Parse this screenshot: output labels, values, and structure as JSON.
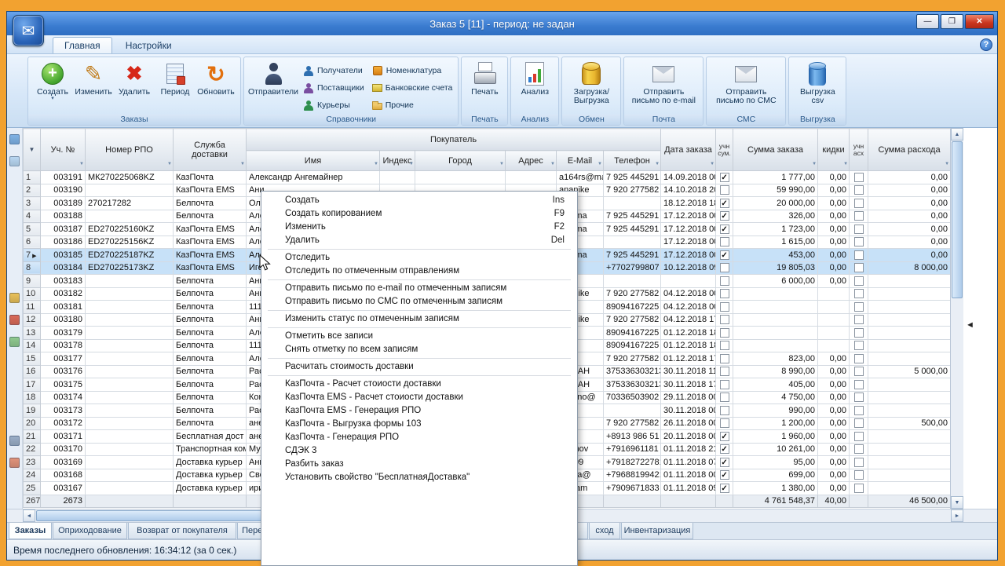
{
  "window": {
    "title": "Заказ 5 [11] - период: не задан",
    "controls": {
      "minimize": "—",
      "maximize": "❒",
      "close": "✕"
    },
    "help": "?"
  },
  "icons": {
    "app": "✉",
    "filter": "▼",
    "corner_filter": "▼",
    "row_marker": "▶",
    "collapse_left": "◄",
    "scroll_up": "▲",
    "scroll_down": "▼",
    "scroll_left": "◄",
    "scroll_right": "►"
  },
  "ribbon": {
    "tabs": [
      {
        "label": "Главная",
        "active": true
      },
      {
        "label": "Настройки",
        "active": false
      }
    ],
    "orders_group": {
      "label": "Заказы",
      "buttons": [
        {
          "label": "Создать",
          "icon": "create-icon",
          "dropdown": true
        },
        {
          "label": "Изменить",
          "icon": "edit-icon"
        },
        {
          "label": "Удалить",
          "icon": "delete-icon"
        },
        {
          "label": "Период",
          "icon": "period-icon"
        },
        {
          "label": "Обновить",
          "icon": "refresh-icon"
        }
      ]
    },
    "ref_group": {
      "label": "Справочники",
      "big": {
        "label": "Отправители",
        "icon": "senders-icon"
      },
      "items": [
        {
          "label": "Получатели",
          "icon": "recipients-icon person-s"
        },
        {
          "label": "Поставщики",
          "icon": "suppliers-icon person-s"
        },
        {
          "label": "Курьеры",
          "icon": "couriers-icon person-s"
        },
        {
          "label": "Номенклатура",
          "icon": "nomenclature-icon"
        },
        {
          "label": "Банковские счета",
          "icon": "bank-accounts-icon"
        },
        {
          "label": "Прочие",
          "icon": "other-icon"
        }
      ]
    },
    "single_groups": [
      {
        "label": "Печать",
        "lines": [
          "Печать"
        ],
        "icon": "print-icon"
      },
      {
        "label": "Анализ",
        "lines": [
          "Анализ"
        ],
        "icon": "analysis-icon"
      },
      {
        "label": "Обмен",
        "lines": [
          "Загрузка/",
          "Выгрузка"
        ],
        "icon": "exchange-icon"
      },
      {
        "label": "Почта",
        "lines": [
          "Отправить",
          "письмо по e-mail"
        ],
        "icon": "email-icon"
      },
      {
        "label": "СМС",
        "lines": [
          "Отправить",
          "письмо по СМС"
        ],
        "icon": "sms-icon"
      },
      {
        "label": "Выгрузка",
        "lines": [
          "Выгрузка",
          "csv"
        ],
        "icon": "csv-icon"
      }
    ]
  },
  "table": {
    "group_header": "Покупатель",
    "columns": [
      "",
      "Уч. №",
      "Номер РПО",
      "Служба доставки",
      "Имя",
      "Индекс",
      "Город",
      "Адрес",
      "E-Mail",
      "Телефон",
      "Дата заказа",
      "учн сум.",
      "Сумма заказа",
      "кидки",
      "учн асх",
      "Сумма расхода"
    ],
    "rows": [
      [
        "1",
        "003191",
        "МК270225068KZ",
        "КазПочта",
        "Александр Ангемайнер",
        "",
        "",
        "",
        "a164rs@ma",
        "7 925 445291",
        "14.09.2018 00:",
        true,
        "1 777,00",
        "0,00",
        false,
        "0,00"
      ],
      [
        "2",
        "003190",
        "",
        "КазПочта EMS",
        "Ани",
        "",
        "",
        "",
        "ananike",
        "7 920 277582",
        "14.10.2018 20:",
        false,
        "59 990,00",
        "0,00",
        false,
        "0,00"
      ],
      [
        "3",
        "003189",
        "270217282",
        "Белпочта",
        "Оле",
        "",
        "",
        "",
        "",
        "",
        "18.12.2018 18:",
        true,
        "20 000,00",
        "0,00",
        false,
        "0,00"
      ],
      [
        "4",
        "003188",
        "",
        "Белпочта",
        "Але",
        "",
        "",
        "",
        "rs@ma",
        "7 925 445291",
        "17.12.2018 00:",
        true,
        "326,00",
        "0,00",
        false,
        "0,00"
      ],
      [
        "5",
        "003187",
        "ED270225160KZ",
        "КазПочта EMS",
        "Але",
        "",
        "",
        "",
        "rs@ma",
        "7 925 445291",
        "17.12.2018 00:",
        true,
        "1 723,00",
        "0,00",
        false,
        "0,00"
      ],
      [
        "6",
        "003186",
        "ED270225156KZ",
        "КазПочта EMS",
        "Але",
        "",
        "",
        "",
        "",
        "",
        "17.12.2018 00:",
        false,
        "1 615,00",
        "0,00",
        false,
        "0,00"
      ],
      [
        "7",
        "003185",
        "ED270225187KZ",
        "КазПочта EMS",
        "Але",
        "",
        "",
        "",
        "rs@ma",
        "7 925 445291",
        "17.12.2018 00:",
        true,
        "453,00",
        "0,00",
        false,
        "0,00"
      ],
      [
        "8",
        "003184",
        "ED270225173KZ",
        "КазПочта EMS",
        "Иго",
        "",
        "",
        "",
        "",
        "+7702799807",
        "10.12.2018 09:",
        false,
        "19 805,03",
        "0,00",
        false,
        "8 000,00"
      ],
      [
        "9",
        "003183",
        "",
        "Белпочта",
        "Ани",
        "",
        "",
        "",
        "",
        "",
        "",
        false,
        "6 000,00",
        "0,00",
        false,
        ""
      ],
      [
        "10",
        "003182",
        "",
        "Белпочта",
        "Ани",
        "",
        "",
        "",
        "ananike",
        "7 920 277582",
        "04.12.2018 00:",
        false,
        "",
        "",
        false,
        ""
      ],
      [
        "11",
        "003181",
        "",
        "Белпочта",
        "111",
        "",
        "",
        "",
        "",
        "89094167225",
        "04.12.2018 00:",
        false,
        "",
        "",
        false,
        ""
      ],
      [
        "12",
        "003180",
        "",
        "Белпочта",
        "Ани",
        "",
        "",
        "",
        "ananike",
        "7 920 277582",
        "04.12.2018 17:",
        false,
        "",
        "",
        false,
        ""
      ],
      [
        "13",
        "003179",
        "",
        "Белпочта",
        "Але",
        "",
        "",
        "",
        "",
        "89094167225",
        "01.12.2018 18:",
        false,
        "",
        "",
        false,
        ""
      ],
      [
        "14",
        "003178",
        "",
        "Белпочта",
        "111",
        "",
        "",
        "",
        "",
        "89094167225",
        "01.12.2018 18:",
        false,
        "",
        "",
        false,
        ""
      ],
      [
        "15",
        "003177",
        "",
        "Белпочта",
        "Але",
        "",
        "",
        "",
        "",
        "7 920 277582",
        "01.12.2018 17:",
        false,
        "823,00",
        "0,00",
        false,
        ""
      ],
      [
        "16",
        "003176",
        "",
        "Белпочта",
        "Рас",
        "",
        "",
        "",
        "5OMAH",
        "375336303213",
        "30.11.2018 11:",
        false,
        "8 990,00",
        "0,00",
        false,
        "5 000,00"
      ],
      [
        "17",
        "003175",
        "",
        "Белпочта",
        "Рас",
        "",
        "",
        "",
        "5OMAH",
        "375336303213",
        "30.11.2018 17:",
        false,
        "405,00",
        "0,00",
        false,
        ""
      ],
      [
        "18",
        "003174",
        "",
        "Белпочта",
        "Кон",
        "",
        "",
        "",
        "ristiano@",
        "70336503902",
        "29.11.2018 00:",
        false,
        "4 750,00",
        "0,00",
        false,
        ""
      ],
      [
        "19",
        "003173",
        "",
        "Белпочта",
        "Рас",
        "",
        "",
        "",
        "",
        "",
        "30.11.2018 00:",
        false,
        "990,00",
        "0,00",
        false,
        ""
      ],
      [
        "20",
        "003172",
        "",
        "Белпочта",
        "ане",
        "",
        "",
        "",
        "",
        "7 920 277582",
        "26.11.2018 00:",
        false,
        "1 200,00",
        "0,00",
        false,
        "500,00"
      ],
      [
        "21",
        "003171",
        "",
        "Бесплатная дост",
        "ане",
        "",
        "",
        "",
        "",
        "+8913 986 51",
        "20.11.2018 00:",
        true,
        "1 960,00",
        "0,00",
        false,
        ""
      ],
      [
        "22",
        "003170",
        "",
        "Транспортная ком",
        "Мус",
        "",
        "",
        "",
        "uslimov",
        "+7916961181",
        "01.11.2018 21:",
        true,
        "10 261,00",
        "0,00",
        false,
        ""
      ],
      [
        "23",
        "003169",
        "",
        "Доставка курьер",
        "Анн",
        "",
        "",
        "",
        "-97.09",
        "+79182722781",
        "01.11.2018 07:",
        true,
        "95,00",
        "0,00",
        false,
        ""
      ],
      [
        "24",
        "003168",
        "",
        "Доставка курьер",
        "Све",
        "",
        "",
        "",
        "bigina@",
        "+79688199421",
        "01.11.2018 00:",
        true,
        "699,00",
        "0,00",
        false,
        ""
      ],
      [
        "25",
        "003167",
        "",
        "Доставка курьер",
        "ири",
        "",
        "",
        "",
        "9@ram",
        "+7909671833",
        "01.11.2018 09:",
        true,
        "1 380,00",
        "0,00",
        false,
        ""
      ]
    ],
    "total_row": [
      "2673",
      "2673",
      "",
      "",
      "",
      "",
      "",
      "",
      "",
      "",
      "",
      null,
      "4 761 548,37",
      "40,00",
      null,
      "46 500,00"
    ],
    "selected_rows": [
      7,
      8
    ],
    "current_row": 7
  },
  "context_menu": {
    "items": [
      {
        "label": "Создать",
        "shortcut": "Ins"
      },
      {
        "label": "Создать копированием",
        "shortcut": "F9"
      },
      {
        "label": "Изменить",
        "shortcut": "F2"
      },
      {
        "label": "Удалить",
        "shortcut": "Del"
      },
      {
        "sep": true
      },
      {
        "label": "Отследить"
      },
      {
        "label": "Отследить по отмеченным отправлениям"
      },
      {
        "sep": true
      },
      {
        "label": "Отправить письмо по e-mail по отмеченным записям"
      },
      {
        "label": "Отправить письмо по СМС по отмеченным записям"
      },
      {
        "sep": true
      },
      {
        "label": "Изменить статус по отмеченным записям"
      },
      {
        "sep": true
      },
      {
        "label": "Отметить все записи"
      },
      {
        "label": "Снять отметку по всем записям"
      },
      {
        "sep": true
      },
      {
        "label": "Расчитать стоимость доставки"
      },
      {
        "sep": true
      },
      {
        "label": "КазПочта - Расчет стоиости доставки"
      },
      {
        "label": "КазПочта EMS - Расчет стоиости доставки"
      },
      {
        "label": "КазПочта EMS - Генерация РПО"
      },
      {
        "label": "КазПочта - Выгрузка формы 103"
      },
      {
        "label": "КазПочта - Генерация РПО"
      },
      {
        "label": "СДЭК 3"
      },
      {
        "label": "Разбить заказ"
      },
      {
        "label": "Установить свойство \"БесплатнаяДоставка\""
      }
    ]
  },
  "doc_tabs": [
    {
      "label": "Заказы",
      "active": true
    },
    {
      "label": "Оприходование"
    },
    {
      "label": "Возврат от покупателя"
    },
    {
      "label": "Перем"
    },
    {
      "label": ""
    },
    {
      "label": "сход"
    },
    {
      "label": "Инвентаризация"
    }
  ],
  "statusbar": {
    "text": "Время последнего обновления: 16:34:12 (за 0 сек.)"
  },
  "left_rail": {
    "icon_colors": [
      "#7fb2e5",
      "#b9d7f2",
      "#e8c05a",
      "#d96a5a",
      "#8fc98f",
      "#9aaec7",
      "#e0927a"
    ]
  },
  "colors": {
    "desktop": "#f2a230",
    "titlebar": "#3b7cd0",
    "selection": "#c7e1f8",
    "close_red": "#c9351f"
  }
}
